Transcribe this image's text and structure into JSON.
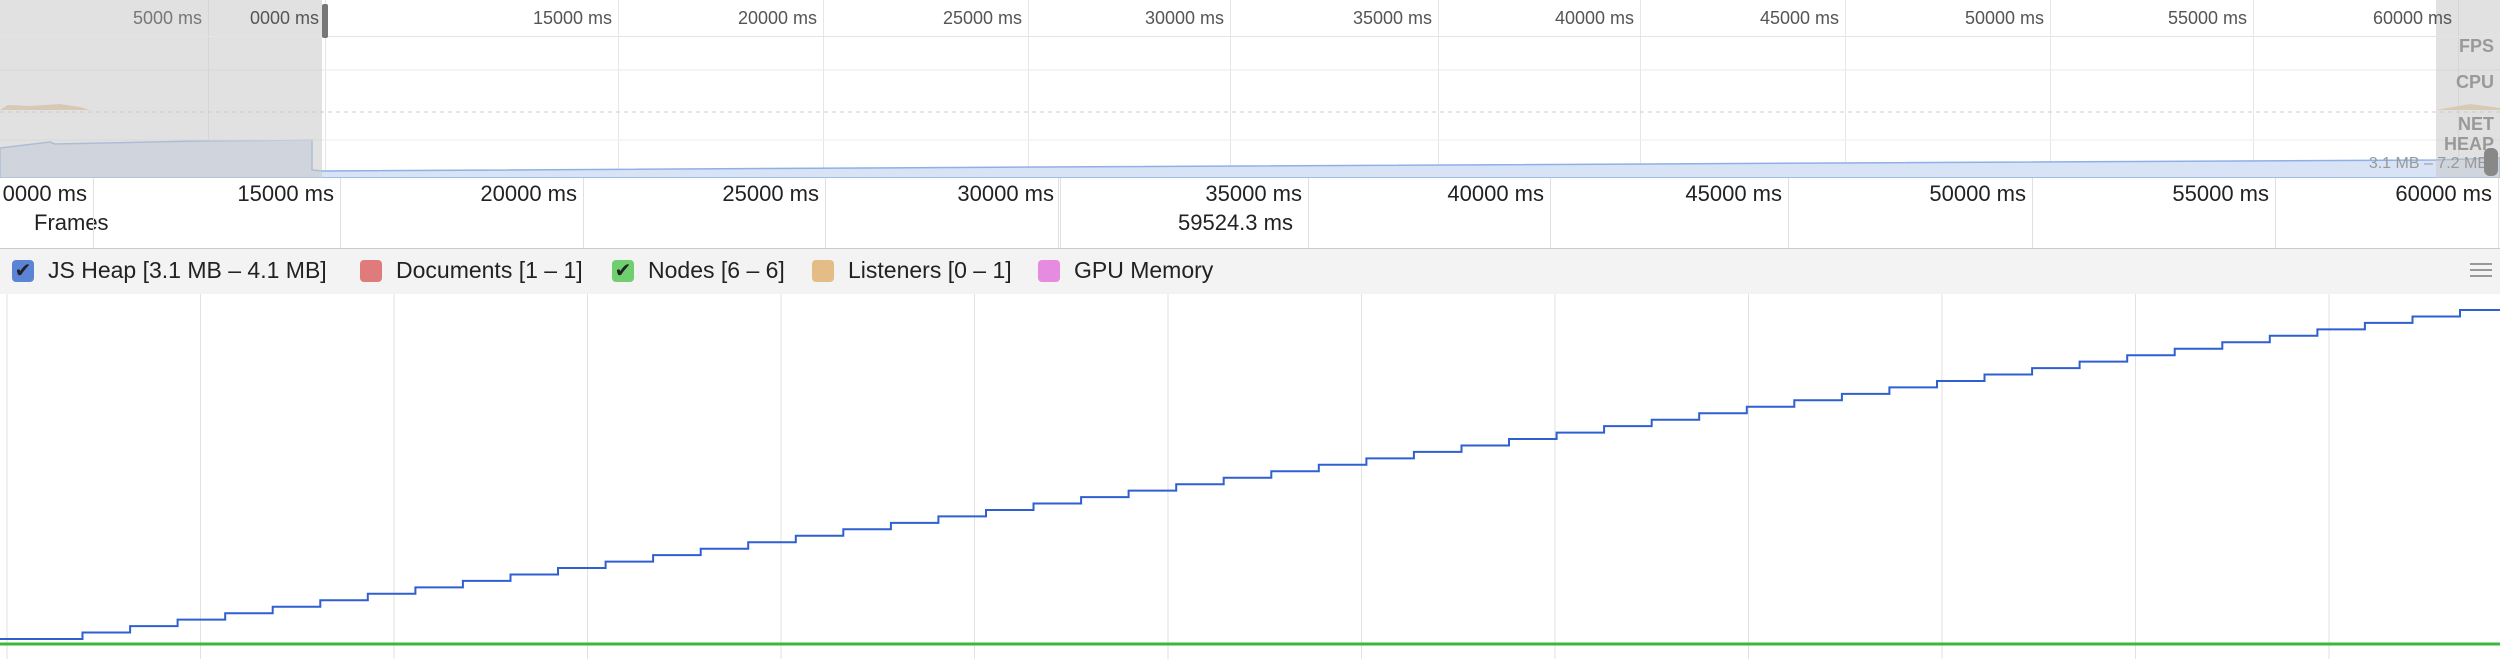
{
  "overview": {
    "tick_labels": [
      {
        "label": "5000 ms",
        "at": 0.083
      },
      {
        "label": "0000 ms",
        "at": 0.13
      },
      {
        "label": "15000 ms",
        "at": 0.247
      },
      {
        "label": "20000 ms",
        "at": 0.329
      },
      {
        "label": "25000 ms",
        "at": 0.411
      },
      {
        "label": "30000 ms",
        "at": 0.492
      },
      {
        "label": "35000 ms",
        "at": 0.575
      },
      {
        "label": "40000 ms",
        "at": 0.656
      },
      {
        "label": "45000 ms",
        "at": 0.738
      },
      {
        "label": "50000 ms",
        "at": 0.82
      },
      {
        "label": "55000 ms",
        "at": 0.901
      },
      {
        "label": "60000 ms",
        "at": 0.983
      }
    ],
    "categories": [
      "FPS",
      "CPU",
      "NET",
      "HEAP"
    ],
    "heap_range": "3.1 MB – 7.2 MB"
  },
  "ruler": {
    "tick_labels": [
      {
        "label": "0000 ms",
        "at": 0.037
      },
      {
        "label": "15000 ms",
        "at": 0.136
      },
      {
        "label": "20000 ms",
        "at": 0.233
      },
      {
        "label": "25000 ms",
        "at": 0.33
      },
      {
        "label": "30000 ms",
        "at": 0.424
      },
      {
        "label": "35000 ms",
        "at": 0.523
      },
      {
        "label": "40000 ms",
        "at": 0.62
      },
      {
        "label": "45000 ms",
        "at": 0.715
      },
      {
        "label": "50000 ms",
        "at": 0.813
      },
      {
        "label": "55000 ms",
        "at": 0.91
      },
      {
        "label": "60000 ms",
        "at": 1.0
      }
    ],
    "frames_label": "Frames",
    "cursor_time": "59524.3 ms"
  },
  "counters": [
    {
      "label": "JS Heap [3.1 MB – 4.1 MB]",
      "color": "#5b83d6",
      "checked": true
    },
    {
      "label": "Documents [1 – 1]",
      "color": "#e07b7b",
      "checked": false
    },
    {
      "label": "Nodes [6 – 6]",
      "color": "#6fcf6f",
      "checked": true
    },
    {
      "label": "Listeners [0 – 1]",
      "color": "#e3bd85",
      "checked": false
    },
    {
      "label": "GPU Memory",
      "color": "#e58be0",
      "checked": false
    }
  ],
  "colors": {
    "heap_line": "#2f5fd0",
    "nodes_line": "#3bb83b"
  },
  "icons": {
    "check": "check-icon",
    "menu": "hamburger-menu-icon"
  },
  "chart_data": {
    "type": "line",
    "series": [
      {
        "name": "JS Heap [3.1 MB – 4.1 MB]",
        "trend": "staircase increasing from 3.1 MB to 4.1 MB",
        "steps": 51
      },
      {
        "name": "Nodes [6 – 6]",
        "trend": "constant at 6"
      }
    ],
    "y_range_heap": [
      3.1,
      4.1
    ],
    "grid": true
  }
}
